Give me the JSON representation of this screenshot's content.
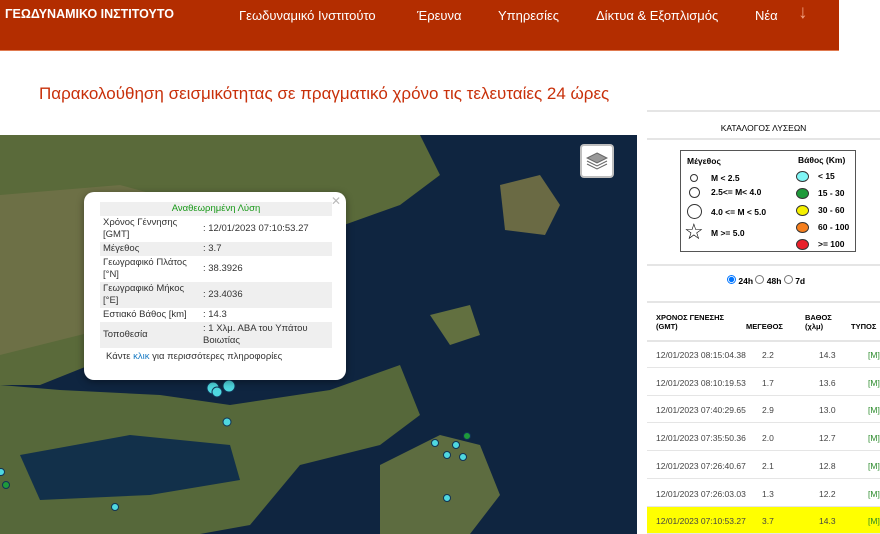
{
  "header": {
    "logo": "ΓΕΩΔΥΝΑΜΙΚΟ ΙΝΣΤΙΤΟΥΤΟ",
    "nav": [
      "Γεωδυναμικό Ινστιτούτο",
      "Έρευνα",
      "Υπηρεσίες",
      "Δίκτυα & Εξοπλισμός",
      "Νέα"
    ],
    "more_icon": "arrow-down-icon"
  },
  "page_title": "Παρακολούθηση σεισμικότητας σε πραγματικό χρόνο τις τελευταίες 24 ώρες",
  "popup": {
    "heading": "Αναθεωρημένη Λύση",
    "rows": [
      {
        "label": "Χρόνος Γέννησης [GMT]",
        "value": ": 12/01/2023 07:10:53.27"
      },
      {
        "label": "Μέγεθος",
        "value": ": 3.7"
      },
      {
        "label": "Γεωγραφικό Πλάτος [°N]",
        "value": ": 38.3926"
      },
      {
        "label": "Γεωγραφικό Μήκος [°E]",
        "value": ": 23.4036"
      },
      {
        "label": "Εστιακό Βάθος [km]",
        "value": ": 14.3"
      },
      {
        "label": "Τοποθεσία",
        "value": ": 1 Χλμ. ΑΒΑ του Υπάτου Βοιωτίας"
      }
    ],
    "more_pre": "Κάντε ",
    "more_link": "κλικ",
    "more_post": " για περισσότερες πληροφορίες"
  },
  "catalog": {
    "title": "ΚΑΤΑΛΟΓΟΣ ΛΥΣΕΩΝ",
    "legend": {
      "mag_title": "Μέγεθος",
      "mag": [
        "M < 2.5",
        "2.5<= M< 4.0",
        "4.0 <= M < 5.0",
        "M >= 5.0"
      ],
      "depth_title": "Βάθος (Km)",
      "depth": [
        {
          "label": "< 15",
          "color": "#7ff5f5"
        },
        {
          "label": "15 - 30",
          "color": "#1e9a3a"
        },
        {
          "label": "30 - 60",
          "color": "#f5f000"
        },
        {
          "label": "60 - 100",
          "color": "#f57f1e"
        },
        {
          "label": ">= 100",
          "color": "#e8202a"
        }
      ]
    },
    "ranges": [
      "24h",
      "48h",
      "7d"
    ],
    "selected_range": "24h",
    "columns": [
      "ΧΡΟΝΟΣ ΓΕΝΕΣΗΣ (GMT)",
      "ΜΕΓΕΘΟΣ",
      "ΒΑΘΟΣ (χλμ)",
      "ΤΥΠΟΣ"
    ],
    "rows": [
      {
        "time": "12/01/2023 08:15:04.38",
        "mag": "2.2",
        "depth": "14.3",
        "type": "[M]"
      },
      {
        "time": "12/01/2023 08:10:19.53",
        "mag": "1.7",
        "depth": "13.6",
        "type": "[M]"
      },
      {
        "time": "12/01/2023 07:40:29.65",
        "mag": "2.9",
        "depth": "13.0",
        "type": "[M]"
      },
      {
        "time": "12/01/2023 07:35:50.36",
        "mag": "2.0",
        "depth": "12.7",
        "type": "[M]"
      },
      {
        "time": "12/01/2023 07:26:40.67",
        "mag": "2.1",
        "depth": "12.8",
        "type": "[M]"
      },
      {
        "time": "12/01/2023 07:26:03.03",
        "mag": "1.3",
        "depth": "12.2",
        "type": "[M]"
      },
      {
        "time": "12/01/2023 07:10:53.27",
        "mag": "3.7",
        "depth": "14.3",
        "type": "[M]",
        "highlighted": true
      }
    ]
  }
}
